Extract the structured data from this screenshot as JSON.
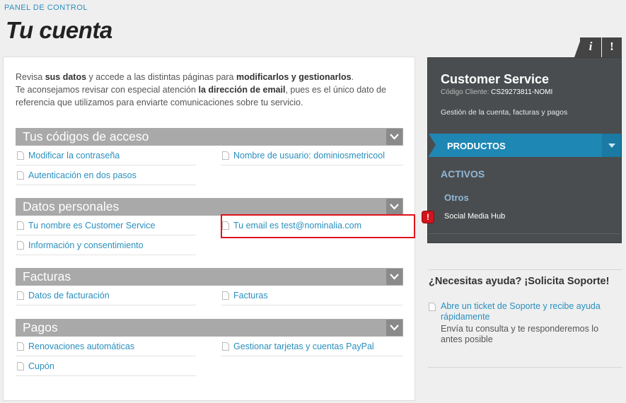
{
  "header": {
    "breadcrumb": "PANEL DE CONTROL",
    "title": "Tu cuenta"
  },
  "intro": {
    "line1_a": "Revisa ",
    "line1_b": "sus datos",
    "line1_c": " y accede a las distintas páginas para ",
    "line1_d": "modificarlos y gestionarlos",
    "line1_e": ".",
    "line2_a": "Te aconsejamos revisar con especial atención ",
    "line2_b": "la dirección de email",
    "line2_c": ", pues es el único dato de referencia que utilizamos para enviarte comunicaciones sobre tu servicio."
  },
  "sections": [
    {
      "title": "Tus códigos de acceso",
      "links": [
        "Modificar la contraseña",
        "Nombre de usuario: dominiosmetricool",
        "Autenticación en dos pasos"
      ]
    },
    {
      "title": "Datos personales",
      "links": [
        "Tu nombre es Customer Service",
        "Tu email es test@nominalia.com",
        "Información y consentimiento"
      ]
    },
    {
      "title": "Facturas",
      "links": [
        "Datos de facturación",
        "Facturas"
      ]
    },
    {
      "title": "Pagos",
      "links": [
        "Renovaciones automáticas",
        "Gestionar tarjetas y cuentas PayPal",
        "Cupón"
      ]
    }
  ],
  "info_tabs": {
    "info": "i",
    "alert": "!"
  },
  "customer": {
    "name": "Customer Service",
    "code_label": "Código Cliente: ",
    "code": "CS29273811-NOMI",
    "description": "Gestión de la cuenta, facturas y pagos",
    "products_label": "PRODUCTOS",
    "active_label": "ACTIVOS",
    "others_label": "Otros",
    "product_item": "Social Media Hub",
    "product_alert": "!"
  },
  "help": {
    "title": "¿Necesitas ayuda? ¡Solicita Soporte!",
    "link": "Abre un ticket de Soporte y recibe ayuda rápidamente",
    "text": "Envía tu consulta y te responderemos lo antes posible"
  },
  "colors": {
    "link": "#2a8fbd",
    "section_header": "#a9a9a9",
    "panel_dark": "#4a4d4f",
    "accent_blue": "#1f87b4",
    "highlight": "#e0141c"
  }
}
